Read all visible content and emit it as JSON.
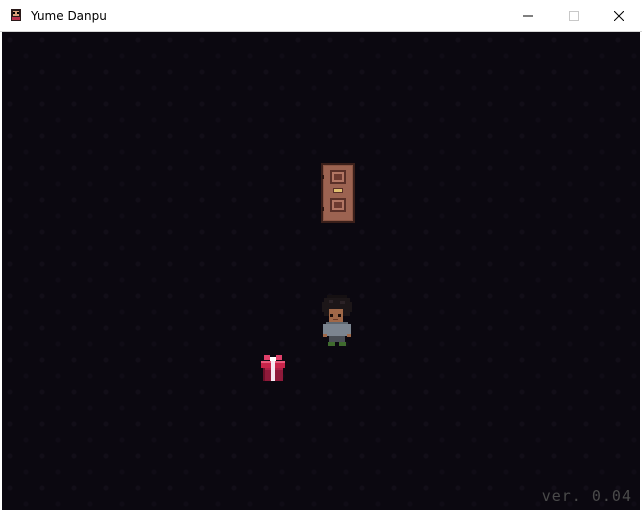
{
  "window": {
    "title": "Yume Danpu",
    "icon": "app-icon",
    "controls": [
      "minimize-icon",
      "maximize-icon",
      "close-icon"
    ]
  },
  "game": {
    "background_color": "#0b0810",
    "objects": [
      "door",
      "player-character",
      "gift-box"
    ],
    "version_label": "ver. 0.04"
  }
}
